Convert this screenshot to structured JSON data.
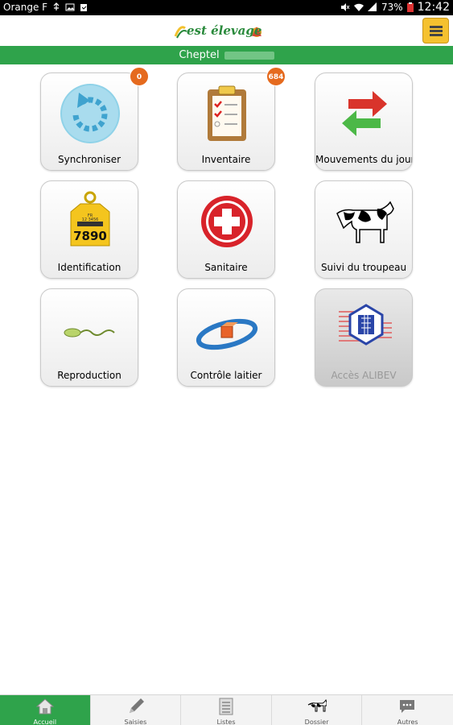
{
  "status_bar": {
    "carrier": "Orange F",
    "battery": "73%",
    "time": "12:42"
  },
  "app_bar": {
    "logo_text": "est élevage",
    "menu_icon": "hamburger-menu-icon"
  },
  "cheptel_bar": {
    "label": "Cheptel"
  },
  "tiles": [
    {
      "label": "Synchroniser",
      "badge": "0",
      "icon": "sync-icon"
    },
    {
      "label": "Inventaire",
      "badge": "684",
      "icon": "clipboard-checklist-icon"
    },
    {
      "label": "Mouvements du jour",
      "icon": "transfer-arrows-icon"
    },
    {
      "label": "Identification",
      "icon": "ear-tag-icon",
      "tag_number": "7890",
      "tag_prefix": "FR",
      "tag_code": "12 3456"
    },
    {
      "label": "Sanitaire",
      "icon": "red-cross-icon"
    },
    {
      "label": "Suivi du troupeau",
      "icon": "cow-icon"
    },
    {
      "label": "Reproduction",
      "icon": "sperm-icon"
    },
    {
      "label": "Contrôle laitier",
      "icon": "milk-control-icon"
    },
    {
      "label": "Accès ALIBEV",
      "icon": "alibev-logo-icon",
      "disabled": true
    }
  ],
  "bottom_nav": [
    {
      "label": "Accueil",
      "icon": "home-icon",
      "active": true
    },
    {
      "label": "Saisies",
      "icon": "pencil-icon"
    },
    {
      "label": "Listes",
      "icon": "list-icon"
    },
    {
      "label": "Dossier",
      "icon": "cow-icon"
    },
    {
      "label": "Autres",
      "icon": "chat-bubble-icon"
    }
  ],
  "colors": {
    "primary_green": "#2fa34b",
    "badge_orange": "#e56a1e",
    "menu_yellow": "#f5c12f"
  }
}
